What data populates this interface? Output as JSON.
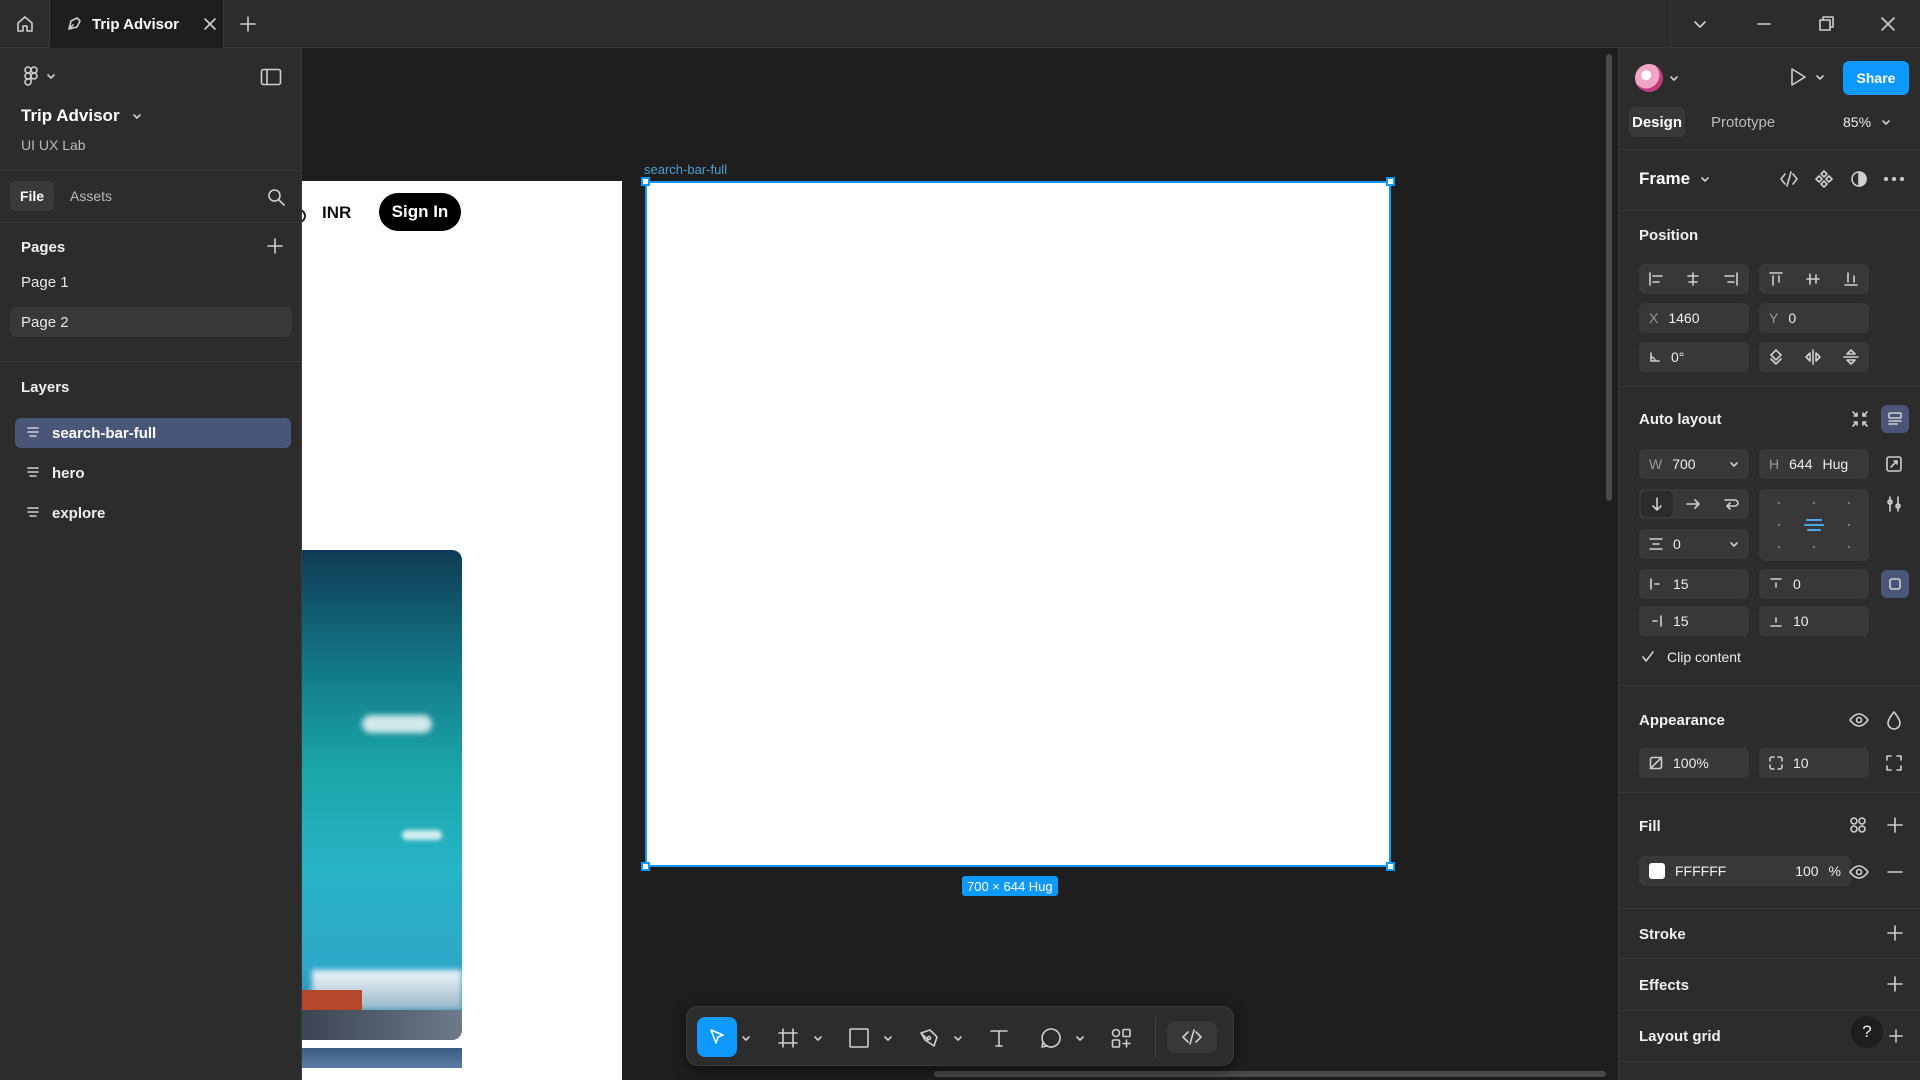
{
  "titlebar": {
    "tab_title": "Trip Advisor",
    "new_tab": "+"
  },
  "left": {
    "project_name": "Trip Advisor",
    "team_name": "UI UX Lab",
    "tabs": [
      "File",
      "Assets"
    ],
    "pages_heading": "Pages",
    "pages": [
      "Page 1",
      "Page 2"
    ],
    "layers_heading": "Layers",
    "layers": [
      "search-bar-full",
      "hero",
      "explore"
    ]
  },
  "canvas": {
    "frame_label": "search-bar-full",
    "size_badge": "700 × 644 Hug",
    "preview_currency": "INR",
    "preview_signin": "Sign In"
  },
  "right": {
    "share_label": "Share",
    "tabs": [
      "Design",
      "Prototype"
    ],
    "zoom": "85%",
    "frame_type": "Frame",
    "position_heading": "Position",
    "x_label": "X",
    "x_value": "1460",
    "y_label": "Y",
    "y_value": "0",
    "rotation": "0°",
    "auto_layout_heading": "Auto layout",
    "w_label": "W",
    "w_value": "700",
    "h_label": "H",
    "h_value": "644",
    "h_mode": "Hug",
    "gap_value": "0",
    "pad_left": "15",
    "pad_top": "0",
    "pad_right": "15",
    "pad_bottom": "10",
    "clip_content": "Clip content",
    "appearance_heading": "Appearance",
    "opacity": "100%",
    "radius": "10",
    "fill_heading": "Fill",
    "fill_hex": "FFFFFF",
    "fill_opacity": "100",
    "fill_pct": "%",
    "stroke_heading": "Stroke",
    "effects_heading": "Effects",
    "layout_grid_heading": "Layout grid",
    "help": "?"
  },
  "colors": {
    "accent": "#0d99ff",
    "panel": "#2c2c2c",
    "canvas": "#1e1e1e",
    "selected_layer": "#4a5678"
  }
}
